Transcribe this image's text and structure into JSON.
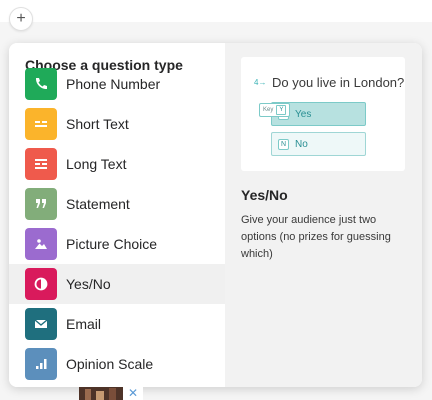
{
  "toolbar": {
    "add_label": "+"
  },
  "chooser": {
    "title": "Choose a question type",
    "types": [
      {
        "label": "Phone Number",
        "color": "#1faa59",
        "icon": "phone-icon"
      },
      {
        "label": "Short Text",
        "color": "#fbb42b",
        "icon": "short-text-icon"
      },
      {
        "label": "Long Text",
        "color": "#ef5a4c",
        "icon": "long-text-icon"
      },
      {
        "label": "Statement",
        "color": "#82ad7a",
        "icon": "quote-icon"
      },
      {
        "label": "Picture Choice",
        "color": "#9b6bcf",
        "icon": "picture-icon"
      },
      {
        "label": "Yes/No",
        "color": "#d91a5c",
        "icon": "yes-no-icon"
      },
      {
        "label": "Email",
        "color": "#1f6f7e",
        "icon": "email-icon"
      },
      {
        "label": "Opinion Scale",
        "color": "#5c8fbc",
        "icon": "opinion-scale-icon"
      }
    ],
    "selected_index": 5
  },
  "preview": {
    "question_number": "4→",
    "question_text": "Do you live in London?",
    "key_hint_label": "Key",
    "key_hint_key": "Y",
    "choices": [
      {
        "key": "Y",
        "label": "Yes"
      },
      {
        "key": "N",
        "label": "No"
      }
    ],
    "title": "Yes/No",
    "description": "Give your audience just two options (no prizes for guessing which)",
    "accent_color": "#3bb3b6"
  },
  "bottom": {
    "close_label": "✕"
  }
}
